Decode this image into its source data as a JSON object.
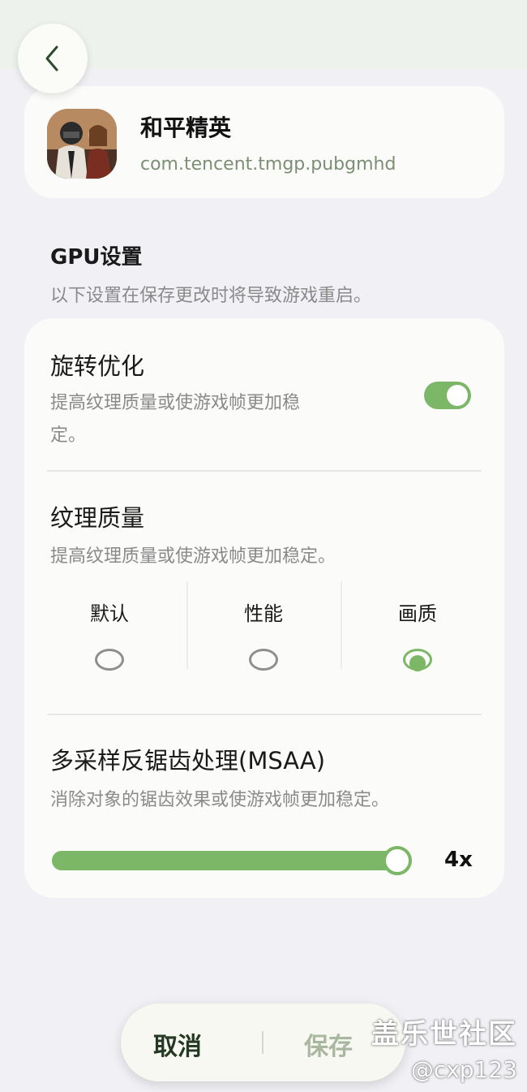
{
  "header": {
    "back_icon": "chevron-left-icon"
  },
  "app": {
    "name": "和平精英",
    "package": "com.tencent.tmgp.pubgmhd",
    "icon": "game-app-icon"
  },
  "gpu_section": {
    "title": "GPU设置",
    "subtitle": "以下设置在保存更改时将导致游戏重启。"
  },
  "rotation_opt": {
    "title": "旋转优化",
    "description": "提高纹理质量或使游戏帧更加稳定。",
    "desc_line1": "提高纹理质量或使游戏帧更加稳",
    "desc_line2": "定。",
    "enabled": true
  },
  "texture_quality": {
    "title": "纹理质量",
    "description": "提高纹理质量或使游戏帧更加稳定。",
    "options": [
      {
        "label": "默认",
        "checked": false
      },
      {
        "label": "性能",
        "checked": false
      },
      {
        "label": "画质",
        "checked": true
      }
    ]
  },
  "msaa": {
    "title": "多采样反锯齿处理(MSAA)",
    "description": "消除对象的锯齿效果或使游戏帧更加稳定。",
    "value_label": "4x",
    "level_fraction": 1.0
  },
  "footer": {
    "cancel_label": "取消",
    "save_label": "保存"
  },
  "watermark": {
    "site": "盖乐世社区",
    "user": "@cxp123"
  },
  "colors": {
    "accent": "#7bb767",
    "background": "#f1f1f5",
    "card": "#fbfbf9",
    "secondary_text": "#8a8a8a",
    "package_text": "#7c8f74"
  }
}
